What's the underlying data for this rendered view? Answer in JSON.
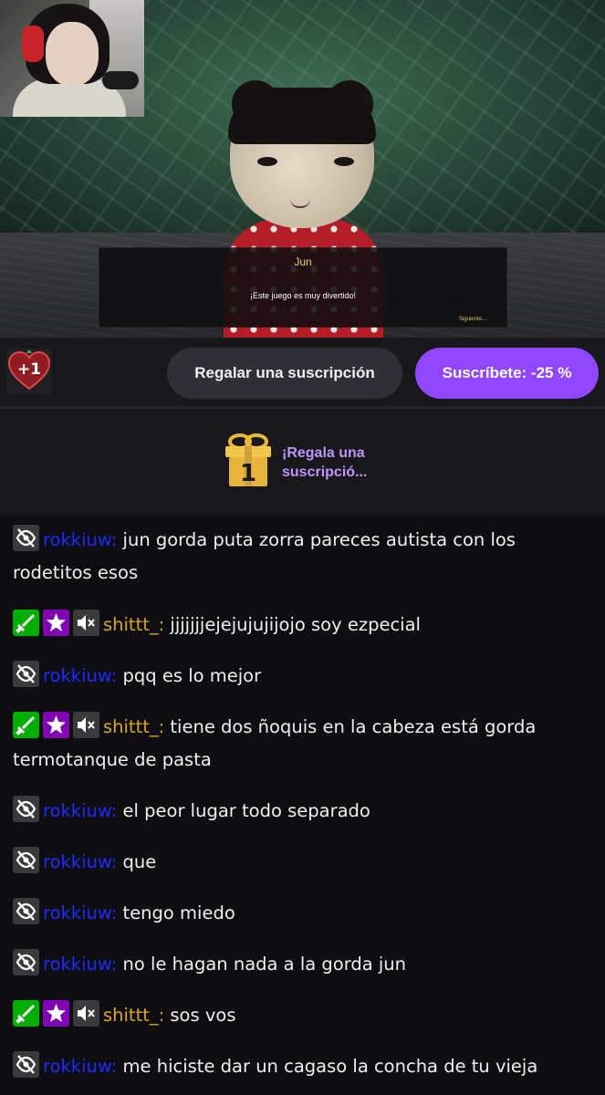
{
  "stream": {
    "dialog": {
      "speaker": "Jun",
      "line": "¡Este juego es muy divertido!",
      "next": "Siguiente..."
    }
  },
  "actions": {
    "reward_badge": "+1",
    "gift_button": "Regalar una suscripción",
    "subscribe_button": "Suscríbete: -25 %"
  },
  "gift_banner": {
    "count": "1",
    "label": "¡Regala una suscripció..."
  },
  "colors": {
    "accent": "#9147ff",
    "gift_text": "#bf94ff",
    "user_rokkiuw": "#1e2bff",
    "user_shittt": "#daa520"
  },
  "chat": {
    "messages": [
      {
        "user": "rokkiuw:",
        "text": " jun gorda puta zorra pareces autista con los rodetitos esos"
      },
      {
        "user": "shittt_:",
        "text": " jjjjjjjejejujujijojo soy ezpecial"
      },
      {
        "user": "rokkiuw:",
        "text": " pqq es lo mejor"
      },
      {
        "user": "shittt_:",
        "text": " tiene dos ñoquis en la cabeza está gorda termotanque de pasta"
      },
      {
        "user": "rokkiuw:",
        "text": " el peor lugar todo separado"
      },
      {
        "user": "rokkiuw:",
        "text": " que"
      },
      {
        "user": "rokkiuw:",
        "text": " tengo miedo"
      },
      {
        "user": "rokkiuw:",
        "text": " no le hagan nada a la gorda jun"
      },
      {
        "user": "shittt_:",
        "text": " sos vos"
      },
      {
        "user": "rokkiuw:",
        "text": " me hiciste dar un cagaso la concha de tu vieja"
      }
    ]
  }
}
